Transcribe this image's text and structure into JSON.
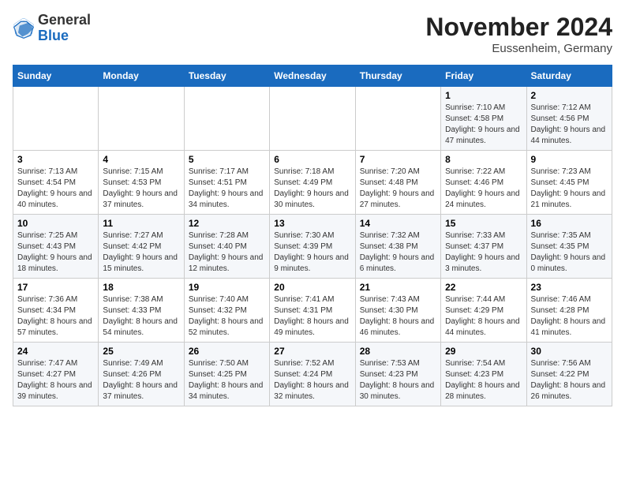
{
  "header": {
    "logo_general": "General",
    "logo_blue": "Blue",
    "month_title": "November 2024",
    "location": "Eussenheim, Germany"
  },
  "calendar": {
    "day_headers": [
      "Sunday",
      "Monday",
      "Tuesday",
      "Wednesday",
      "Thursday",
      "Friday",
      "Saturday"
    ],
    "weeks": [
      [
        {
          "day": "",
          "info": ""
        },
        {
          "day": "",
          "info": ""
        },
        {
          "day": "",
          "info": ""
        },
        {
          "day": "",
          "info": ""
        },
        {
          "day": "",
          "info": ""
        },
        {
          "day": "1",
          "info": "Sunrise: 7:10 AM\nSunset: 4:58 PM\nDaylight: 9 hours and 47 minutes."
        },
        {
          "day": "2",
          "info": "Sunrise: 7:12 AM\nSunset: 4:56 PM\nDaylight: 9 hours and 44 minutes."
        }
      ],
      [
        {
          "day": "3",
          "info": "Sunrise: 7:13 AM\nSunset: 4:54 PM\nDaylight: 9 hours and 40 minutes."
        },
        {
          "day": "4",
          "info": "Sunrise: 7:15 AM\nSunset: 4:53 PM\nDaylight: 9 hours and 37 minutes."
        },
        {
          "day": "5",
          "info": "Sunrise: 7:17 AM\nSunset: 4:51 PM\nDaylight: 9 hours and 34 minutes."
        },
        {
          "day": "6",
          "info": "Sunrise: 7:18 AM\nSunset: 4:49 PM\nDaylight: 9 hours and 30 minutes."
        },
        {
          "day": "7",
          "info": "Sunrise: 7:20 AM\nSunset: 4:48 PM\nDaylight: 9 hours and 27 minutes."
        },
        {
          "day": "8",
          "info": "Sunrise: 7:22 AM\nSunset: 4:46 PM\nDaylight: 9 hours and 24 minutes."
        },
        {
          "day": "9",
          "info": "Sunrise: 7:23 AM\nSunset: 4:45 PM\nDaylight: 9 hours and 21 minutes."
        }
      ],
      [
        {
          "day": "10",
          "info": "Sunrise: 7:25 AM\nSunset: 4:43 PM\nDaylight: 9 hours and 18 minutes."
        },
        {
          "day": "11",
          "info": "Sunrise: 7:27 AM\nSunset: 4:42 PM\nDaylight: 9 hours and 15 minutes."
        },
        {
          "day": "12",
          "info": "Sunrise: 7:28 AM\nSunset: 4:40 PM\nDaylight: 9 hours and 12 minutes."
        },
        {
          "day": "13",
          "info": "Sunrise: 7:30 AM\nSunset: 4:39 PM\nDaylight: 9 hours and 9 minutes."
        },
        {
          "day": "14",
          "info": "Sunrise: 7:32 AM\nSunset: 4:38 PM\nDaylight: 9 hours and 6 minutes."
        },
        {
          "day": "15",
          "info": "Sunrise: 7:33 AM\nSunset: 4:37 PM\nDaylight: 9 hours and 3 minutes."
        },
        {
          "day": "16",
          "info": "Sunrise: 7:35 AM\nSunset: 4:35 PM\nDaylight: 9 hours and 0 minutes."
        }
      ],
      [
        {
          "day": "17",
          "info": "Sunrise: 7:36 AM\nSunset: 4:34 PM\nDaylight: 8 hours and 57 minutes."
        },
        {
          "day": "18",
          "info": "Sunrise: 7:38 AM\nSunset: 4:33 PM\nDaylight: 8 hours and 54 minutes."
        },
        {
          "day": "19",
          "info": "Sunrise: 7:40 AM\nSunset: 4:32 PM\nDaylight: 8 hours and 52 minutes."
        },
        {
          "day": "20",
          "info": "Sunrise: 7:41 AM\nSunset: 4:31 PM\nDaylight: 8 hours and 49 minutes."
        },
        {
          "day": "21",
          "info": "Sunrise: 7:43 AM\nSunset: 4:30 PM\nDaylight: 8 hours and 46 minutes."
        },
        {
          "day": "22",
          "info": "Sunrise: 7:44 AM\nSunset: 4:29 PM\nDaylight: 8 hours and 44 minutes."
        },
        {
          "day": "23",
          "info": "Sunrise: 7:46 AM\nSunset: 4:28 PM\nDaylight: 8 hours and 41 minutes."
        }
      ],
      [
        {
          "day": "24",
          "info": "Sunrise: 7:47 AM\nSunset: 4:27 PM\nDaylight: 8 hours and 39 minutes."
        },
        {
          "day": "25",
          "info": "Sunrise: 7:49 AM\nSunset: 4:26 PM\nDaylight: 8 hours and 37 minutes."
        },
        {
          "day": "26",
          "info": "Sunrise: 7:50 AM\nSunset: 4:25 PM\nDaylight: 8 hours and 34 minutes."
        },
        {
          "day": "27",
          "info": "Sunrise: 7:52 AM\nSunset: 4:24 PM\nDaylight: 8 hours and 32 minutes."
        },
        {
          "day": "28",
          "info": "Sunrise: 7:53 AM\nSunset: 4:23 PM\nDaylight: 8 hours and 30 minutes."
        },
        {
          "day": "29",
          "info": "Sunrise: 7:54 AM\nSunset: 4:23 PM\nDaylight: 8 hours and 28 minutes."
        },
        {
          "day": "30",
          "info": "Sunrise: 7:56 AM\nSunset: 4:22 PM\nDaylight: 8 hours and 26 minutes."
        }
      ]
    ]
  }
}
